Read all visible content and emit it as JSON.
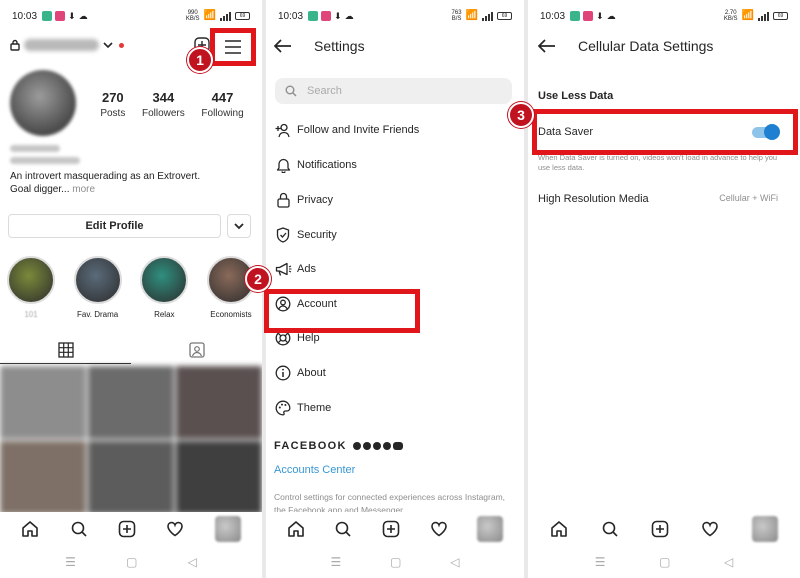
{
  "status": {
    "time": "10:03",
    "p1_speed_top": "990",
    "p1_speed_bot": "KB/S",
    "p2_speed_top": "763",
    "p2_speed_bot": "B/S",
    "p3_speed_top": "2.70",
    "p3_speed_bot": "KB/S",
    "battery": "69"
  },
  "profile": {
    "stats": [
      {
        "num": "270",
        "label": "Posts"
      },
      {
        "num": "344",
        "label": "Followers"
      },
      {
        "num": "447",
        "label": "Following"
      }
    ],
    "bio_line1": "An introvert masquerading as an Extrovert.",
    "bio_line2": "Goal digger...",
    "bio_more": " more",
    "edit_profile": "Edit Profile",
    "highlights": [
      {
        "label": "101",
        "color": "#7a8a3a"
      },
      {
        "label": "Fav. Drama",
        "color": "#5a6b7a"
      },
      {
        "label": "Relax",
        "color": "#2f8f7f"
      },
      {
        "label": "Economists",
        "color": "#8a6a5a"
      }
    ],
    "grid_colors": [
      "#8d8d8d",
      "#6b6b6b",
      "#5a5050",
      "#7e7066",
      "#5c5c5c",
      "#3f3f3f"
    ]
  },
  "settings": {
    "title": "Settings",
    "search_placeholder": "Search",
    "items": [
      {
        "label": "Follow and Invite Friends",
        "icon": "add-person-icon"
      },
      {
        "label": "Notifications",
        "icon": "bell-icon"
      },
      {
        "label": "Privacy",
        "icon": "lock-icon"
      },
      {
        "label": "Security",
        "icon": "shield-icon"
      },
      {
        "label": "Ads",
        "icon": "megaphone-icon"
      },
      {
        "label": "Account",
        "icon": "account-icon"
      },
      {
        "label": "Help",
        "icon": "lifebuoy-icon"
      },
      {
        "label": "About",
        "icon": "info-icon"
      },
      {
        "label": "Theme",
        "icon": "palette-icon"
      }
    ],
    "facebook": "FACEBOOK",
    "accounts_center": "Accounts Center",
    "control_text": "Control settings for connected experiences across Instagram, the Facebook app and Messenger,"
  },
  "cellular": {
    "title": "Cellular Data Settings",
    "section": "Use Less Data",
    "data_saver": "Data Saver",
    "data_saver_on": true,
    "data_saver_desc": "When Data Saver is turned on, videos won't load in advance to help you use less data.",
    "high_res": "High Resolution Media",
    "high_res_value": "Cellular + WiFi"
  },
  "badges": [
    "1",
    "2",
    "3"
  ],
  "colors": {
    "highlight_red": "#e0161b",
    "badge_red": "#c1121f",
    "link_blue": "#3797d5",
    "toggle_blue": "#1f7fd0"
  }
}
